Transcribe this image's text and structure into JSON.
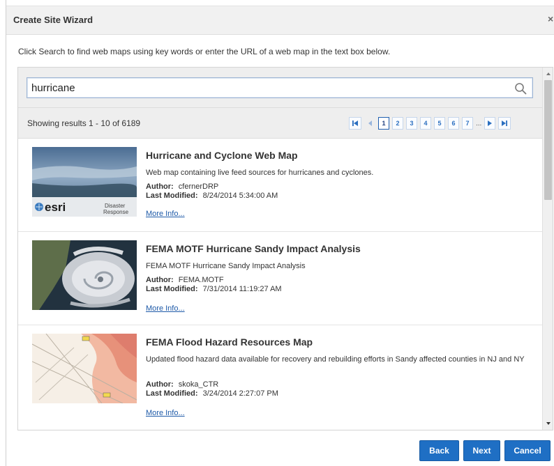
{
  "dialog": {
    "title": "Create Site Wizard",
    "close_glyph": "×",
    "instructions": "Click Search to find web maps using key words or enter the URL of a web map in the text box below."
  },
  "search": {
    "value": "hurricane",
    "icon": "search-icon"
  },
  "results_summary": "Showing results 1 - 10 of 6189",
  "pager": {
    "pages": [
      "1",
      "2",
      "3",
      "4",
      "5",
      "6",
      "7"
    ],
    "current": "1",
    "ellipsis": "...",
    "icons": [
      "first-page-icon",
      "previous-page-icon",
      "next-page-icon",
      "last-page-icon"
    ]
  },
  "results": [
    {
      "title": "Hurricane and Cyclone Web Map",
      "description": "Web map containing live feed sources for hurricanes and cyclones.",
      "author_label": "Author:",
      "author": "cfernerDRP",
      "modified_label": "Last Modified:",
      "modified": "8/24/2014 5:34:00 AM",
      "link": "More Info...",
      "thumb_logo": "esri",
      "thumb_caption_1": "Disaster",
      "thumb_caption_2": "Response"
    },
    {
      "title": "FEMA MOTF Hurricane Sandy Impact Analysis",
      "description": "FEMA MOTF Hurricane Sandy Impact Analysis",
      "author_label": "Author:",
      "author": "FEMA.MOTF",
      "modified_label": "Last Modified:",
      "modified": "7/31/2014 11:19:27 AM",
      "link": "More Info..."
    },
    {
      "title": "FEMA Flood Hazard Resources Map",
      "description": "Updated flood hazard data available for recovery and rebuilding efforts in Sandy affected counties in NJ and NY",
      "author_label": "Author:",
      "author": "skoka_CTR",
      "modified_label": "Last Modified:",
      "modified": "3/24/2014 2:27:07 PM",
      "link": "More Info..."
    }
  ],
  "buttons": {
    "back": "Back",
    "next": "Next",
    "cancel": "Cancel"
  },
  "colors": {
    "primary_button": "#1f6fc4",
    "link": "#1e5aa8",
    "panel_bg": "#eeeeee"
  }
}
